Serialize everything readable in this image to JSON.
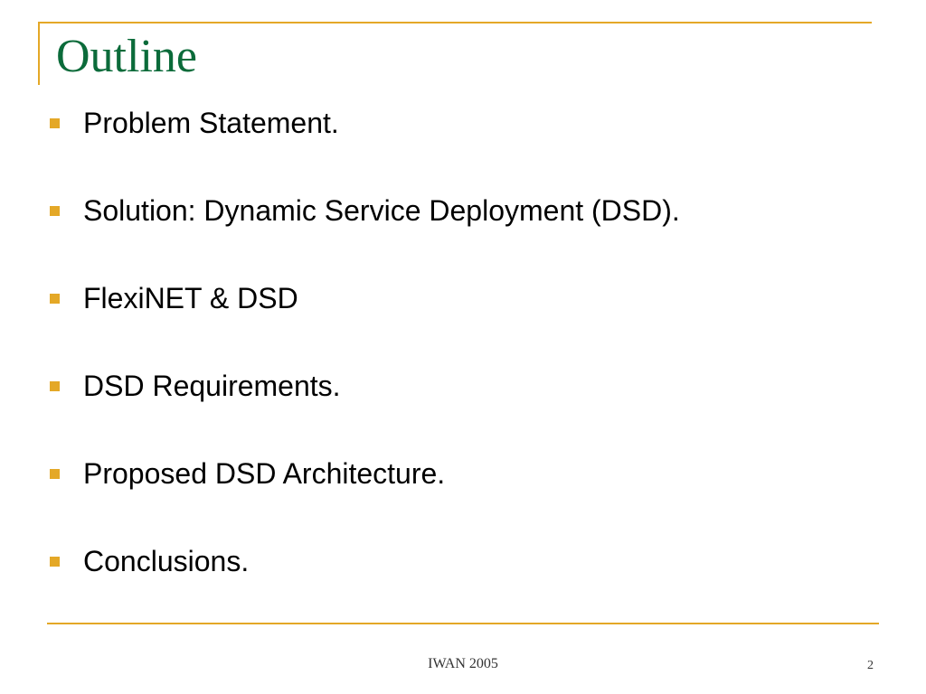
{
  "colors": {
    "title": "#0b6b3a",
    "accent": "#e4a827",
    "bullet": "#e4a827"
  },
  "slide": {
    "title": "Outline",
    "bullets": [
      "Problem Statement.",
      "Solution: Dynamic Service Deployment (DSD).",
      "FlexiNET & DSD",
      "DSD Requirements.",
      "Proposed DSD Architecture.",
      "Conclusions."
    ]
  },
  "footer": {
    "center": "IWAN 2005",
    "page": "2"
  },
  "icons": {
    "bullet": "square-bullet-icon"
  }
}
